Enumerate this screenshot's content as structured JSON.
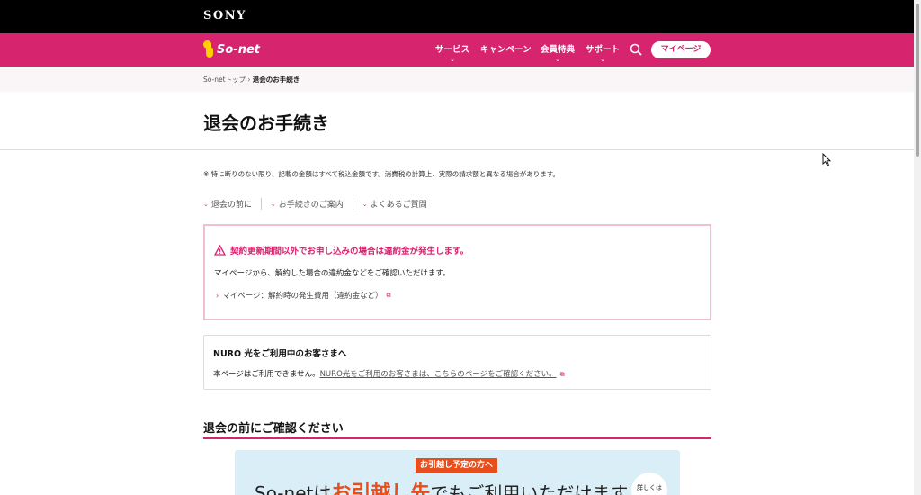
{
  "header": {
    "sony_logo": "SONY",
    "brand": "So-net",
    "nav": [
      {
        "label": "サービス"
      },
      {
        "label": "キャンペーン"
      },
      {
        "label": "会員特典"
      },
      {
        "label": "サポート"
      }
    ],
    "mypage_label": "マイページ"
  },
  "breadcrumb": {
    "home": "So-netトップ",
    "current": "退会のお手続き"
  },
  "page_title": "退会のお手続き",
  "tax_note": "※ 特に断りのない限り、記載の金額はすべて税込金額です。消費税の計算上、実際の請求額と異なる場合があります。",
  "anchors": [
    "退会の前に",
    "お手続きのご案内",
    "よくあるご質問"
  ],
  "warning": {
    "title": "契約更新期間以外でお申し込みの場合は違約金が発生します。",
    "text": "マイページから、解約した場合の違約金などをご確認いただけます。",
    "link": "マイページ：解約時の発生費用（違約金など）"
  },
  "nuro": {
    "title": "NURO 光をご利用中のお客さまへ",
    "text": "本ページはご利用できません。",
    "link": "NURO光をご利用のお客さまは、こちらのページをご確認ください。"
  },
  "section_title": "退会の前にご確認ください",
  "banner": {
    "tag": "お引越し予定の方へ",
    "headline_pre": "So-netは",
    "headline_highlight": "お引越し先",
    "headline_post": "でもご利用いただけます",
    "detail_label": "詳しくは"
  },
  "colors": {
    "brand_pink": "#d6246e",
    "sony_bar": "#000000",
    "banner_bg": "#d9eef7",
    "banner_accent": "#e84e1b"
  }
}
